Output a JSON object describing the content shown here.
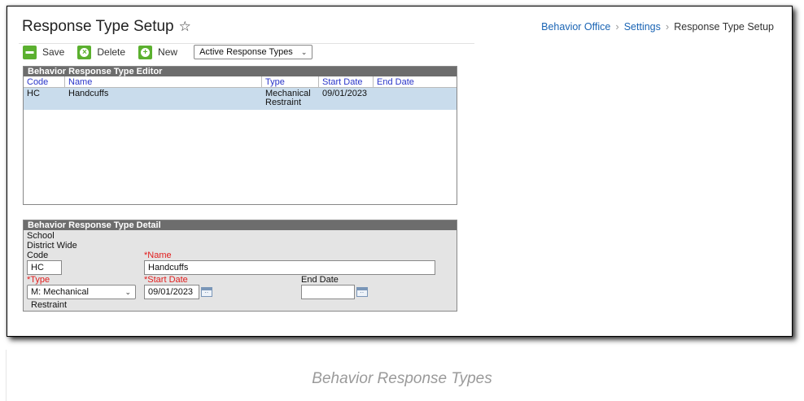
{
  "page": {
    "title": "Response Type Setup",
    "star_icon": "star-outline-icon"
  },
  "breadcrumb": {
    "items": [
      "Behavior Office",
      "Settings",
      "Response Type Setup"
    ]
  },
  "toolbar": {
    "save_label": "Save",
    "delete_label": "Delete",
    "new_label": "New",
    "filter_value": "Active Response Types"
  },
  "editor": {
    "header": "Behavior Response Type Editor",
    "columns": [
      "Code",
      "Name",
      "Type",
      "Start Date",
      "End Date"
    ],
    "rows": [
      {
        "code": "HC",
        "name": "Handcuffs",
        "type_line1": "Mechanical",
        "type_line2": "Restraint",
        "start": "09/01/2023",
        "end": ""
      }
    ]
  },
  "detail": {
    "header": "Behavior Response Type Detail",
    "school_label": "School",
    "school_value": "District Wide",
    "code_label": "Code",
    "code_value": "HC",
    "name_label": "*Name",
    "name_value": "Handcuffs",
    "type_label": "*Type",
    "type_value": "M: Mechanical Restraint",
    "start_label": "*Start Date",
    "start_value": "09/01/2023",
    "end_label": "End Date",
    "end_value": ""
  },
  "caption": "Behavior Response Types",
  "colors": {
    "accent_green": "#5bb02f",
    "link_blue": "#1a64b4",
    "selected_row": "#c9dcec",
    "required_red": "#e21d1d"
  }
}
